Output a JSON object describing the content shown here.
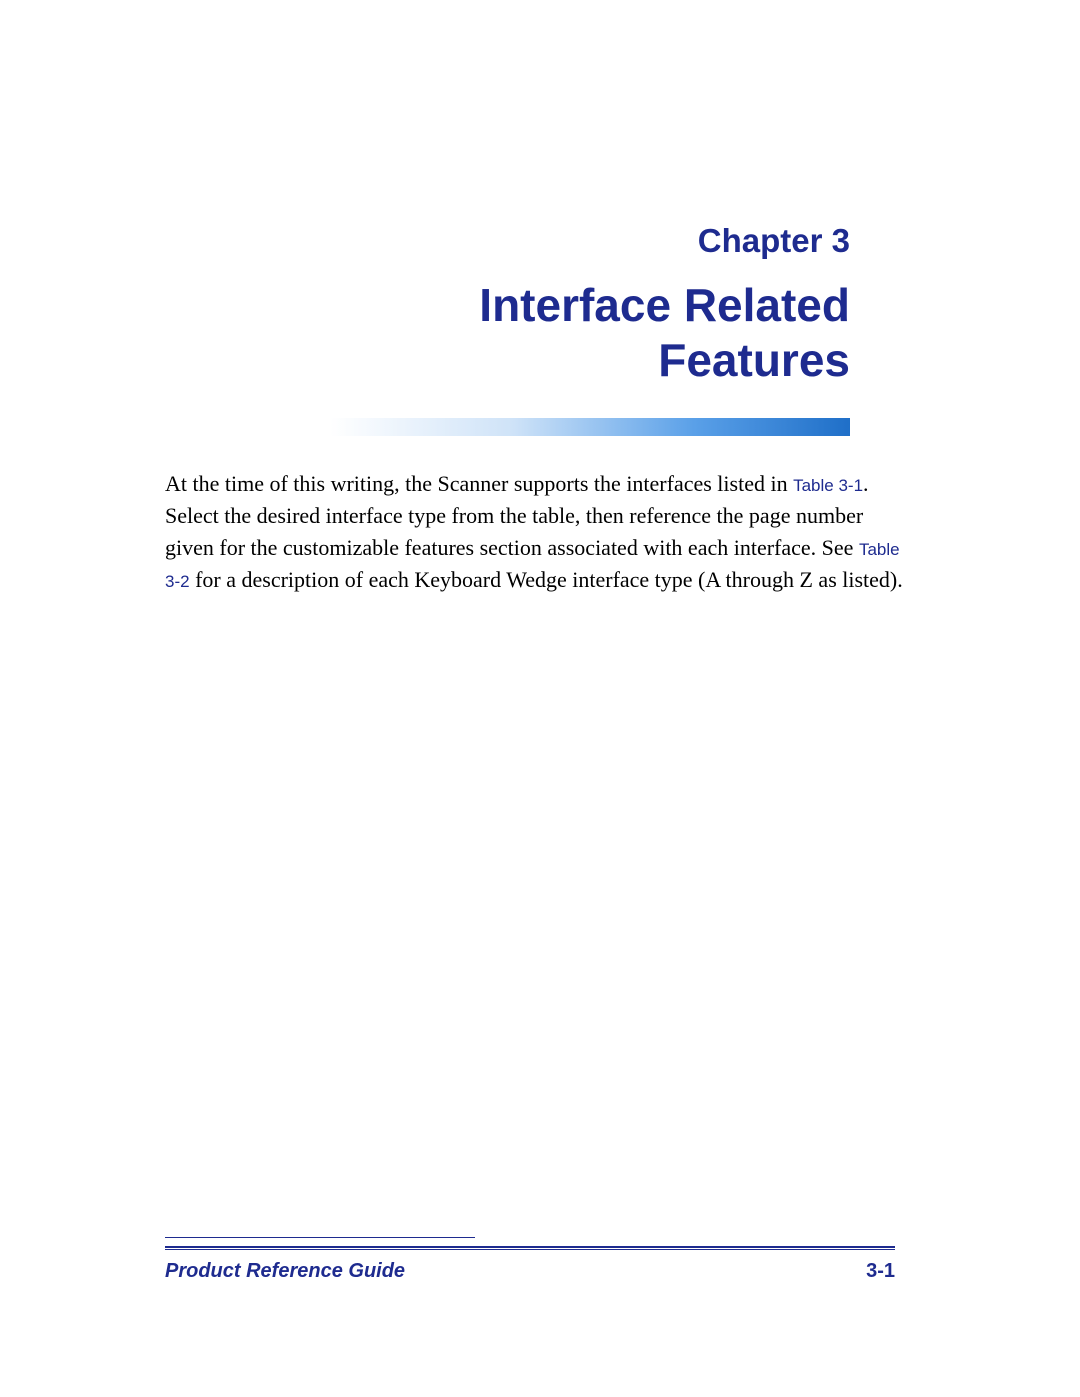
{
  "chapter": {
    "label": "Chapter 3",
    "title_line1": "Interface Related",
    "title_line2": "Features"
  },
  "body": {
    "segment1": "At the time of this writing, the Scanner supports the interfaces listed in ",
    "ref1": "Table 3-1",
    "segment2": ". Select the desired interface type from the table, then reference the page number given for the customizable features section associated with each interface. See ",
    "ref2": "Table 3-2",
    "segment3": " for a description of each Keyboard Wedge interface type (A through Z as listed)."
  },
  "footer": {
    "left": "Product Reference Guide",
    "right": "3-1"
  }
}
